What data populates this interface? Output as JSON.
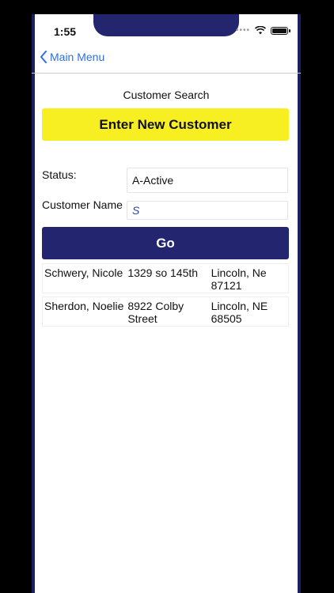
{
  "status_bar": {
    "time": "1:55"
  },
  "nav": {
    "back_label": "Main Menu"
  },
  "page": {
    "title": "Customer Search"
  },
  "buttons": {
    "new_customer": "Enter New Customer",
    "go": "Go"
  },
  "form": {
    "status_label": "Status:",
    "status_value": "A-Active",
    "customer_name_label": "Customer Name",
    "customer_name_value": "S"
  },
  "results": [
    {
      "name": "Schwery, Nicole",
      "address": "1329 so 145th",
      "city": "Lincoln, Ne 87121"
    },
    {
      "name": "Sherdon, Noelie",
      "address": "8922 Colby Street",
      "city": "Lincoln, NE 68505"
    }
  ],
  "colors": {
    "accent_yellow": "#f7ef22",
    "navy": "#23266e",
    "link_blue": "#2f6fde"
  }
}
